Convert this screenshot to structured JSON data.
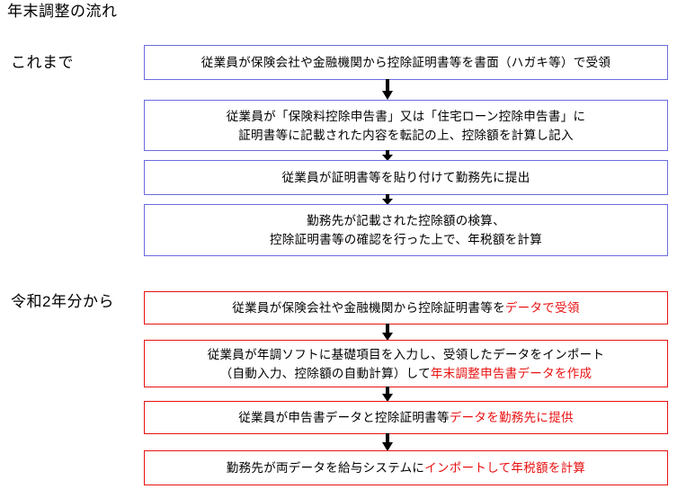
{
  "page": {
    "title": "年末調整の流れ"
  },
  "sections": [
    {
      "id": "past",
      "label": "これまで",
      "border_color": "#6b6be0",
      "steps": [
        {
          "lines": [
            [
              {
                "text": "従業員が保険会社や金融機関から控除証明書等を書面（ハガキ等）で受領",
                "highlight": false
              }
            ]
          ]
        },
        {
          "lines": [
            [
              {
                "text": "従業員が「保険料控除申告書」又は「住宅ローン控除申告書」に",
                "highlight": false
              }
            ],
            [
              {
                "text": "証明書等に記載された内容を転記の上、控除額を計算し記入",
                "highlight": false
              }
            ]
          ]
        },
        {
          "lines": [
            [
              {
                "text": "従業員が証明書等を貼り付けて勤務先に提出",
                "highlight": false
              }
            ]
          ]
        },
        {
          "lines": [
            [
              {
                "text": "勤務先が記載された控除額の検算、",
                "highlight": false
              }
            ],
            [
              {
                "text": "控除証明書等の確認を行った上で、年税額を計算",
                "highlight": false
              }
            ]
          ]
        }
      ]
    },
    {
      "id": "from-r2",
      "label": "令和2年分から",
      "border_color": "#e81111",
      "highlight_color": "#e81111",
      "steps": [
        {
          "lines": [
            [
              {
                "text": "従業員が保険会社や金融機関から控除証明書等を",
                "highlight": false
              },
              {
                "text": "データで受領",
                "highlight": true
              }
            ]
          ]
        },
        {
          "lines": [
            [
              {
                "text": "従業員が年調ソフトに基礎項目を入力し、受領したデータをインポート",
                "highlight": false
              }
            ],
            [
              {
                "text": "（自動入力、控除額の自動計算）して",
                "highlight": false
              },
              {
                "text": "年末調整申告書データを作成",
                "highlight": true
              }
            ]
          ]
        },
        {
          "lines": [
            [
              {
                "text": "従業員が申告書データと控除証明書等",
                "highlight": false
              },
              {
                "text": "データを勤務先に提供",
                "highlight": true
              }
            ]
          ]
        },
        {
          "lines": [
            [
              {
                "text": "勤務先が両データを給与システムに",
                "highlight": false
              },
              {
                "text": "インポートして年税額を計算",
                "highlight": true
              }
            ]
          ]
        }
      ]
    }
  ],
  "connector": {
    "icon": "arrow-down-icon",
    "color": "#000000"
  }
}
